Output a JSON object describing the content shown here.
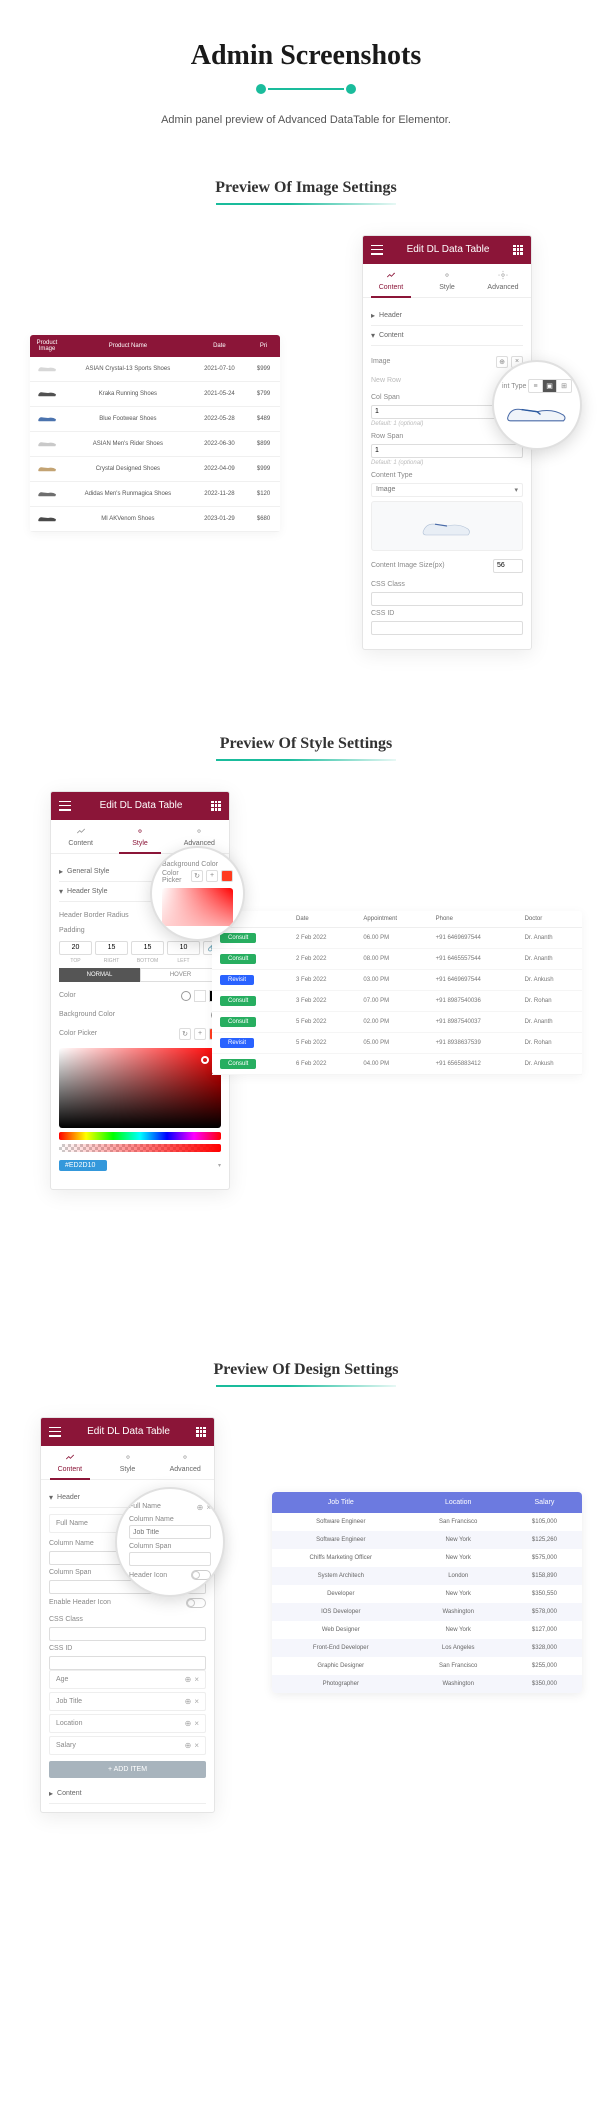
{
  "main_title": "Admin Screenshots",
  "subtitle": "Admin panel preview of Advanced DataTable for Elementor.",
  "sections": {
    "image": "Preview Of Image Settings",
    "style": "Preview Of Style Settings",
    "design": "Preview Of Design Settings"
  },
  "panel_title": "Edit DL Data Table",
  "tabs": {
    "content": "Content",
    "style": "Style",
    "advanced": "Advanced"
  },
  "accordion": {
    "header": "Header",
    "content": "Content",
    "general_style": "General Style",
    "header_style": "Header Style"
  },
  "image_fields": {
    "image_label": "Image",
    "new_row": "New Row",
    "col_span": "Col Span",
    "col_span_val": "1",
    "default1": "Default: 1 (optional)",
    "row_span": "Row Span",
    "row_span_val": "1",
    "content_type": "Content Type",
    "content_type_lbl": "int Type",
    "image_text": "Image",
    "content_image_size": "Content Image Size(px)",
    "size_val": "56",
    "css_class": "CSS Class",
    "css_id": "CSS ID"
  },
  "product_table": {
    "headers": [
      "Product Image",
      "Product Name",
      "Date",
      "Pri"
    ],
    "rows": [
      {
        "name": "ASIAN Crystal-13 Sports Shoes",
        "date": "2021-07-10",
        "price": "$999"
      },
      {
        "name": "Kraka Running Shoes",
        "date": "2021-05-24",
        "price": "$799"
      },
      {
        "name": "Blue Footwear Shoes",
        "date": "2022-05-28",
        "price": "$489"
      },
      {
        "name": "ASIAN Men's Rider Shoes",
        "date": "2022-06-30",
        "price": "$899"
      },
      {
        "name": "Crystal Designed Shoes",
        "date": "2022-04-09",
        "price": "$999"
      },
      {
        "name": "Adidas Men's Runmagica Shoes",
        "date": "2022-11-28",
        "price": "$120"
      },
      {
        "name": "MI AKVenom Shoes",
        "date": "2023-01-29",
        "price": "$680"
      }
    ]
  },
  "style_fields": {
    "bg_color": "Background Color",
    "color_picker": "Color Picker",
    "border_radius": "Header Border Radius",
    "padding": "Padding",
    "padding_vals": [
      "20",
      "15",
      "15",
      "10"
    ],
    "padding_labels": [
      "TOP",
      "RIGHT",
      "BOTTOM",
      "LEFT"
    ],
    "normal": "NORMAL",
    "hover": "HOVER",
    "color": "Color",
    "hex": "#ED2D10"
  },
  "appt_table": {
    "headers": [
      "",
      "Date",
      "Appointment",
      "Phone",
      "Doctor"
    ],
    "rows": [
      {
        "btn": "Consult",
        "btn_class": "btn-consult",
        "date": "2 Feb 2022",
        "time": "06.00 PM",
        "phone": "+91 6469697544",
        "doctor": "Dr. Ananth"
      },
      {
        "btn": "Consult",
        "btn_class": "btn-consult",
        "date": "2 Feb 2022",
        "time": "08.00 PM",
        "phone": "+91 6465557544",
        "doctor": "Dr. Ananth"
      },
      {
        "btn": "Revisit",
        "btn_class": "btn-revisit",
        "date": "3 Feb 2022",
        "time": "03.00 PM",
        "phone": "+91 6469697544",
        "doctor": "Dr. Ankush"
      },
      {
        "btn": "Consult",
        "btn_class": "btn-consult",
        "date": "3 Feb 2022",
        "time": "07.00 PM",
        "phone": "+91 8987540036",
        "doctor": "Dr. Rohan"
      },
      {
        "btn": "Consult",
        "btn_class": "btn-consult",
        "date": "5 Feb 2022",
        "time": "02.00 PM",
        "phone": "+91 8987540037",
        "doctor": "Dr. Ananth"
      },
      {
        "btn": "Revisit",
        "btn_class": "btn-revisit",
        "date": "5 Feb 2022",
        "time": "05.00 PM",
        "phone": "+91 8938637539",
        "doctor": "Dr. Rohan"
      },
      {
        "btn": "Consult",
        "btn_class": "btn-consult",
        "date": "6 Feb 2022",
        "time": "04.00 PM",
        "phone": "+91 6565883412",
        "doctor": "Dr. Ankush"
      }
    ]
  },
  "design_fields": {
    "full_name": "Full Name",
    "column_name": "Column Name",
    "column_span": "Column Span",
    "enable_header_icon": "Enable Header Icon",
    "header_icon": "Header Icon",
    "job_title_ph": "Job Title",
    "age": "Age",
    "job_title": "Job Title",
    "location": "Location",
    "salary": "Salary",
    "add_item": "+  ADD ITEM"
  },
  "salary_table": {
    "headers": [
      "Job Title",
      "Location",
      "Salary"
    ],
    "rows": [
      {
        "title": "Software Engineer",
        "loc": "San Francisco",
        "sal": "$105,000"
      },
      {
        "title": "Software Engineer",
        "loc": "New York",
        "sal": "$125,260"
      },
      {
        "title": "Chiffs Marketing Officer",
        "loc": "New York",
        "sal": "$575,000"
      },
      {
        "title": "System Architech",
        "loc": "London",
        "sal": "$158,890"
      },
      {
        "title": "Developer",
        "loc": "New York",
        "sal": "$350,550"
      },
      {
        "title": "IOS Developer",
        "loc": "Washington",
        "sal": "$578,000"
      },
      {
        "title": "Web Designer",
        "loc": "New York",
        "sal": "$127,000"
      },
      {
        "title": "Front-End Developer",
        "loc": "Los Angeles",
        "sal": "$328,000"
      },
      {
        "title": "Graphic Designer",
        "loc": "San Francisco",
        "sal": "$255,000"
      },
      {
        "title": "Photographer",
        "loc": "Washington",
        "sal": "$350,000"
      }
    ]
  },
  "shoe_colors": [
    "#d0d0d0",
    "#333",
    "#2b5aa0",
    "#c0c0c0",
    "#b8935a",
    "#555",
    "#2a2a2a"
  ]
}
